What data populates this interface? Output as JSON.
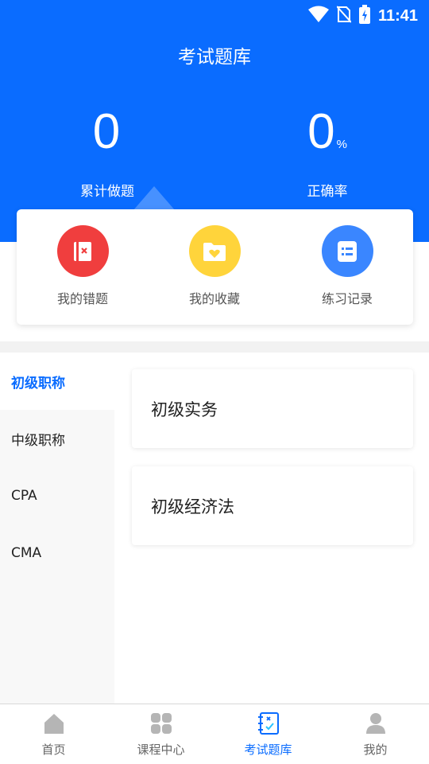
{
  "status_bar": {
    "time": "11:41"
  },
  "header": {
    "title": "考试题库",
    "stats": [
      {
        "value": "0",
        "unit": "",
        "label": "累计做题"
      },
      {
        "value": "0",
        "unit": "%",
        "label": "正确率"
      }
    ]
  },
  "quick_actions": [
    {
      "label": "我的错题",
      "icon": "wrong-questions-icon",
      "color": "#f03e3e"
    },
    {
      "label": "我的收藏",
      "icon": "favorites-folder-icon",
      "color": "#ffd43b"
    },
    {
      "label": "练习记录",
      "icon": "practice-record-icon",
      "color": "#3a86ff"
    }
  ],
  "sidebar": {
    "items": [
      {
        "label": "初级职称",
        "active": true
      },
      {
        "label": "中级职称",
        "active": false
      },
      {
        "label": "CPA",
        "active": false
      },
      {
        "label": "CMA",
        "active": false
      }
    ]
  },
  "courses": [
    {
      "title": "初级实务"
    },
    {
      "title": "初级经济法"
    }
  ],
  "tabbar": {
    "tabs": [
      {
        "label": "首页",
        "icon": "home-icon",
        "active": false
      },
      {
        "label": "课程中心",
        "icon": "grid-icon",
        "active": false
      },
      {
        "label": "考试题库",
        "icon": "question-bank-icon",
        "active": true
      },
      {
        "label": "我的",
        "icon": "profile-icon",
        "active": false
      }
    ]
  },
  "colors": {
    "primary": "#0a6cff",
    "inactive": "#999999"
  }
}
